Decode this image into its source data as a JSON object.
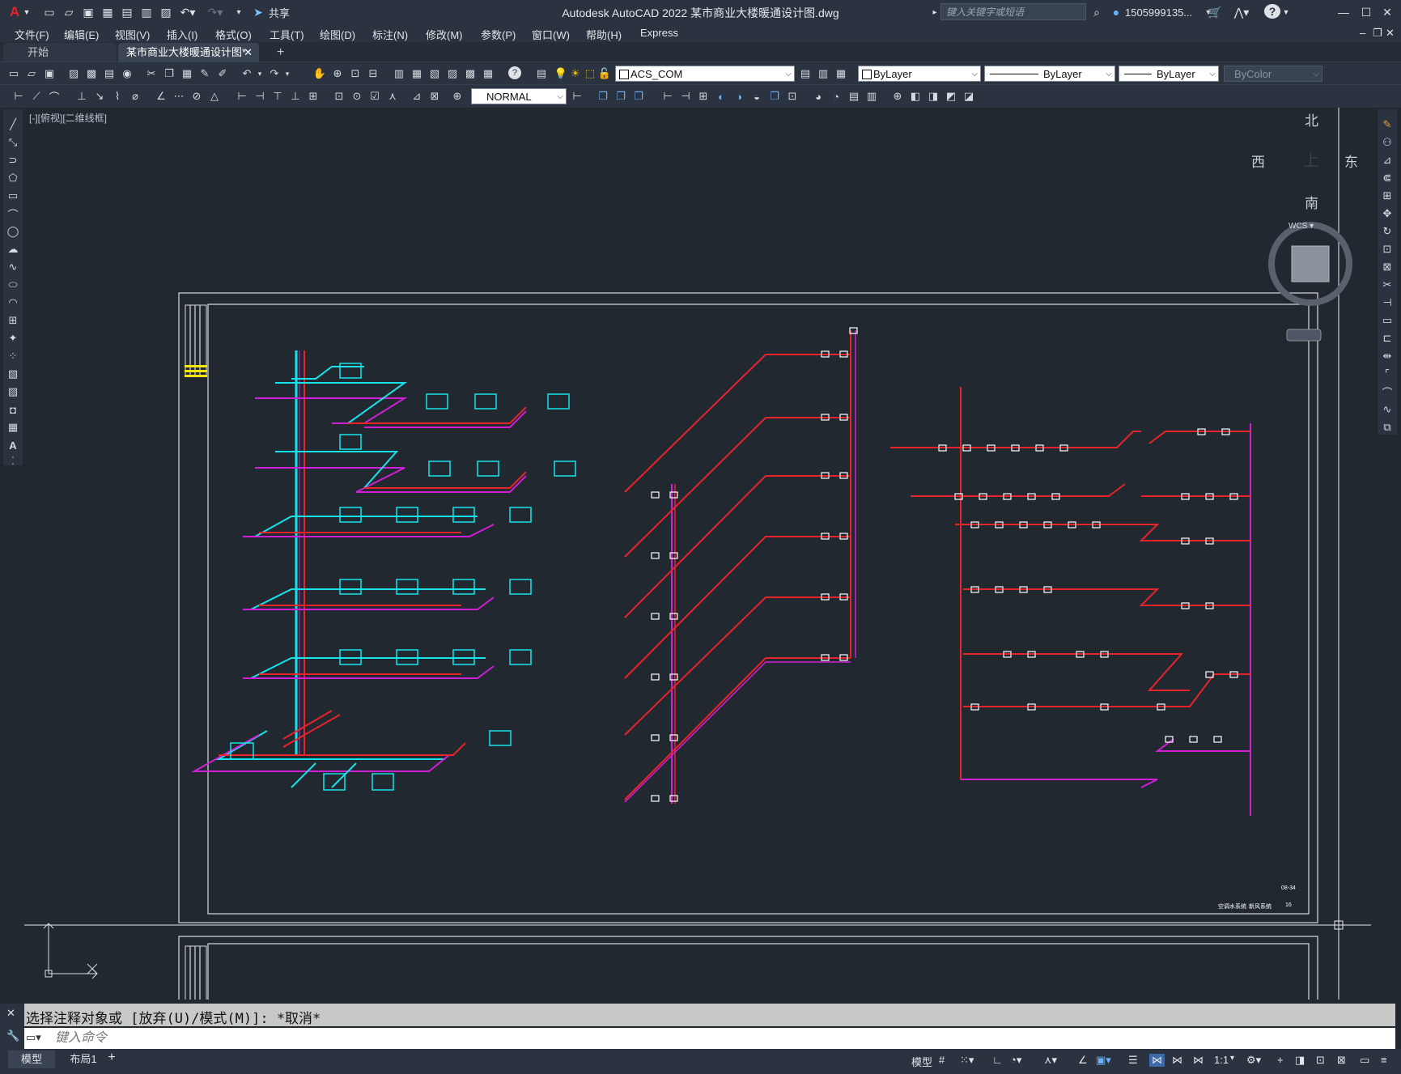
{
  "titlebar": {
    "app_title": "Autodesk AutoCAD 2022    某市商业大楼暖通设计图.dwg",
    "share_label": "共享",
    "search_placeholder": "键入关键字或短语",
    "user_name": "1505999135...",
    "help_label": "?"
  },
  "menu": {
    "items": [
      "文件(F)",
      "编辑(E)",
      "视图(V)",
      "插入(I)",
      "格式(O)",
      "工具(T)",
      "绘图(D)",
      "标注(N)",
      "修改(M)",
      "参数(P)",
      "窗口(W)",
      "帮助(H)",
      "Express"
    ]
  },
  "tabs": {
    "start": "开始",
    "active": "某市商业大楼暖通设计图*",
    "new_tab": "+"
  },
  "toolbar": {
    "layer": "ACS_COM",
    "color": "ByLayer",
    "linetype": "ByLayer",
    "lineweight": "ByLayer",
    "plotstyle": "ByColor",
    "dimstyle": "NORMAL"
  },
  "viewport": {
    "label": "[-][俯视][二维线框]",
    "compass": {
      "north": "北",
      "south": "南",
      "east": "东",
      "west": "西",
      "top": "上"
    },
    "wcs": "WCS ▾",
    "sheet_title_left": "空调水系统",
    "sheet_title_middle": "新风系统",
    "sheet_no": "08-34",
    "sheet_page": "16"
  },
  "commandline": {
    "history": "选择注释对象或 [放弃(U)/模式(M)]: *取消*",
    "placeholder": "键入命令"
  },
  "statusbar": {
    "model_tab": "模型",
    "layout_tab": "布局1",
    "add_layout": "+",
    "model_label": "模型",
    "scale": "1:1"
  },
  "colors": {
    "accent_red": "#e8232a",
    "cyan": "#19e3ea",
    "magenta": "#d11fd6",
    "white": "#ffffff"
  }
}
